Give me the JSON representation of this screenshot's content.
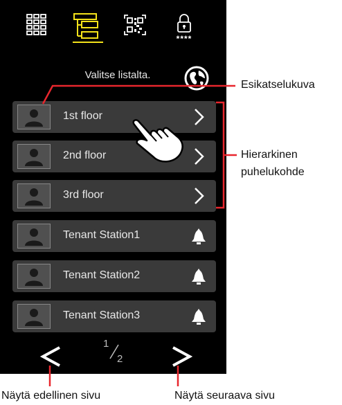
{
  "header": {
    "tabs": [
      {
        "icon": "grid-icon"
      },
      {
        "icon": "hierarchy-list-icon",
        "selected": true
      },
      {
        "icon": "qr-code-icon"
      },
      {
        "icon": "lock-code-icon",
        "caption": "****"
      }
    ],
    "accent_color": "#f5e31a"
  },
  "instruction": "Valitse listalta.",
  "globe_icon": "globe-icon",
  "list": [
    {
      "label": "1st floor",
      "action": "chevron-right-icon"
    },
    {
      "label": "2nd floor",
      "action": "chevron-right-icon"
    },
    {
      "label": "3rd floor",
      "action": "chevron-right-icon"
    },
    {
      "label": "Tenant Station1",
      "action": "bell-icon"
    },
    {
      "label": "Tenant Station2",
      "action": "bell-icon"
    },
    {
      "label": "Tenant Station3",
      "action": "bell-icon"
    }
  ],
  "pager": {
    "current": "1",
    "total": "2"
  },
  "callouts": {
    "preview": "Esikatselukuva",
    "hierarchy_line1": "Hierarkinen",
    "hierarchy_line2": "puhelukohde",
    "prev_page": "Näytä edellinen sivu",
    "next_page": "Näytä seuraava sivu"
  },
  "callout_color": "#e8262d"
}
